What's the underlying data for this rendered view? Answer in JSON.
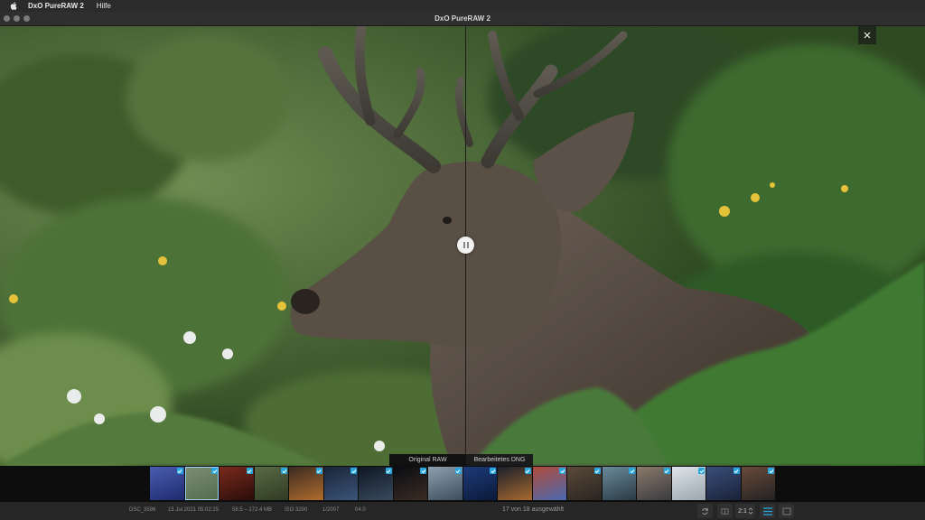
{
  "menubar": {
    "apple_icon": "apple-logo-icon",
    "app_name": "DxO PureRAW 2",
    "items": [
      "Hilfe"
    ]
  },
  "window": {
    "title": "DxO PureRAW 2",
    "traffic_lights": [
      "close",
      "minimize",
      "zoom"
    ]
  },
  "viewer": {
    "close_icon": "close-icon",
    "split_handle_icon": "pause-icon",
    "label_original": "Original RAW",
    "label_processed": "Bearbeitetes DNG"
  },
  "filmstrip": {
    "thumbnails": [
      {
        "checked": true,
        "colors": [
          "#4a5db0",
          "#1e2a6e"
        ]
      },
      {
        "checked": true,
        "colors": [
          "#7c8f73",
          "#556a4d"
        ],
        "selected": true
      },
      {
        "checked": true,
        "colors": [
          "#7a2a1c",
          "#2a0d0a"
        ]
      },
      {
        "checked": true,
        "colors": [
          "#5a6b45",
          "#2e3a22"
        ]
      },
      {
        "checked": true,
        "colors": [
          "#3b2a22",
          "#b06c2d"
        ]
      },
      {
        "checked": true,
        "colors": [
          "#1a2438",
          "#3b5578"
        ]
      },
      {
        "checked": true,
        "colors": [
          "#0e1622",
          "#3a4a5e"
        ]
      },
      {
        "checked": true,
        "colors": [
          "#0a0c12",
          "#3a2c24"
        ]
      },
      {
        "checked": true,
        "colors": [
          "#8ea0ad",
          "#3c4c5a"
        ]
      },
      {
        "checked": true,
        "colors": [
          "#1c3a78",
          "#0c1a3a"
        ]
      },
      {
        "checked": true,
        "colors": [
          "#1b1f2a",
          "#a86a30"
        ]
      },
      {
        "checked": true,
        "colors": [
          "#b04a3a",
          "#4a6ab0"
        ]
      },
      {
        "checked": true,
        "colors": [
          "#5a4a3a",
          "#2a2420"
        ]
      },
      {
        "checked": true,
        "colors": [
          "#6a8a9a",
          "#2a3a44"
        ]
      },
      {
        "checked": true,
        "colors": [
          "#8a7a6a",
          "#3a3a40"
        ]
      },
      {
        "checked": true,
        "colors": [
          "#dfe5ea",
          "#9aa5ae"
        ]
      },
      {
        "checked": true,
        "colors": [
          "#3a4e7a",
          "#1a2238"
        ]
      },
      {
        "checked": true,
        "colors": [
          "#6a4a3a",
          "#222"
        ]
      }
    ]
  },
  "statusbar": {
    "filename": "DSC_3596",
    "date": "15 Jul 2021 05:02:25",
    "size": "58.5 – 172.4 MB",
    "iso": "ISO 3200",
    "shutter": "1/2007",
    "aperture": "f/4.0",
    "selection": "17 von 18 ausgewählt",
    "zoom": "2:1",
    "tool_icons": [
      "rotate-icon",
      "compare-icon",
      "fit-icon",
      "list-view-icon",
      "fullscreen-icon"
    ]
  },
  "colors": {
    "checkbox": "#2aa6de",
    "accent": "#2aa6de"
  }
}
